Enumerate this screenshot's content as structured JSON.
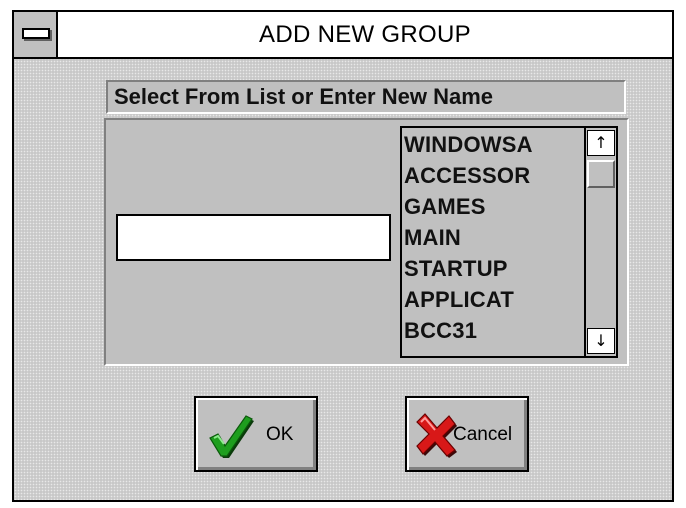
{
  "window": {
    "title": "ADD NEW GROUP"
  },
  "prompt": {
    "label": "Select From List or Enter New Name"
  },
  "name_input": {
    "value": "",
    "placeholder": ""
  },
  "group_list": {
    "items": [
      "WINDOWSA",
      "ACCESSOR",
      "GAMES",
      "MAIN",
      "STARTUP",
      "APPLICAT",
      "BCC31"
    ],
    "scroll_up_glyph": "↑",
    "scroll_down_glyph": "↓"
  },
  "buttons": {
    "ok_label": "OK",
    "ok_icon": "green-checkmark-icon",
    "cancel_label": "Cancel",
    "cancel_icon": "red-x-icon"
  },
  "colors": {
    "face": "#c0c0c0",
    "checkmark": "#1e9e1e",
    "cancel_x": "#d81818"
  }
}
